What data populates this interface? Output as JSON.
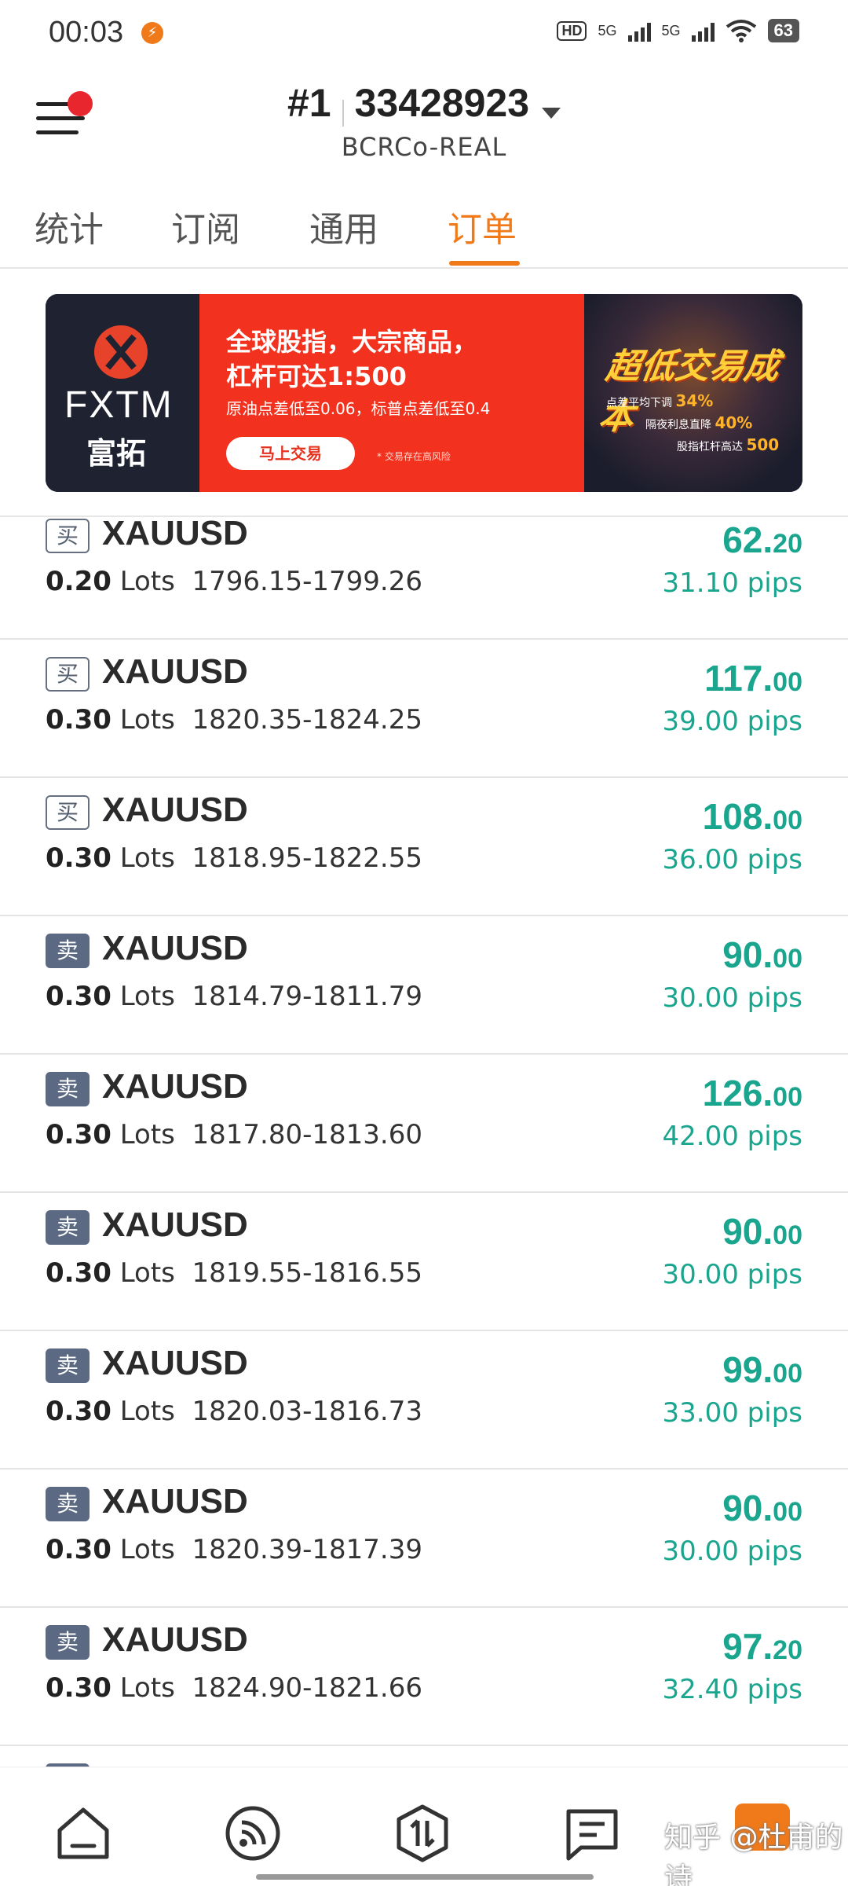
{
  "status_bar": {
    "time": "00:03",
    "hd": "HD",
    "net1": "5G",
    "net2": "5G",
    "battery": "63"
  },
  "header": {
    "account_prefix": "#1",
    "account_number": "33428923",
    "server": "BCRCo-REAL"
  },
  "tabs": [
    {
      "label": "统计",
      "active": false
    },
    {
      "label": "订阅",
      "active": false
    },
    {
      "label": "通用",
      "active": false
    },
    {
      "label": "订单",
      "active": true
    }
  ],
  "banner": {
    "brand": "FXTM",
    "brand_cn": "富拓",
    "headline1": "全球股指，大宗商品，",
    "headline2": "杠杆可达1:500",
    "subline": "原油点差低至0.06，标普点差低至0.4",
    "cta": "马上交易",
    "risk": "* 交易存在高风险",
    "promo_title": "超低交易成本",
    "promo1_text": "点差平均下调",
    "promo1_value": "34%",
    "promo2_text": "隔夜利息直降",
    "promo2_value": "40%",
    "promo3_text": "股指杠杆高达",
    "promo3_value": "500"
  },
  "orders": [
    {
      "side": "买",
      "type": "buy",
      "symbol": "XAUUSD",
      "lots": "0.20",
      "lots_unit": "Lots",
      "prices": "1796.15-1799.26",
      "profit_int": "62.",
      "profit_dec": "20",
      "pips": "31.10 pips"
    },
    {
      "side": "买",
      "type": "buy",
      "symbol": "XAUUSD",
      "lots": "0.30",
      "lots_unit": "Lots",
      "prices": "1820.35-1824.25",
      "profit_int": "117.",
      "profit_dec": "00",
      "pips": "39.00 pips"
    },
    {
      "side": "买",
      "type": "buy",
      "symbol": "XAUUSD",
      "lots": "0.30",
      "lots_unit": "Lots",
      "prices": "1818.95-1822.55",
      "profit_int": "108.",
      "profit_dec": "00",
      "pips": "36.00 pips"
    },
    {
      "side": "卖",
      "type": "sell",
      "symbol": "XAUUSD",
      "lots": "0.30",
      "lots_unit": "Lots",
      "prices": "1814.79-1811.79",
      "profit_int": "90.",
      "profit_dec": "00",
      "pips": "30.00 pips"
    },
    {
      "side": "卖",
      "type": "sell",
      "symbol": "XAUUSD",
      "lots": "0.30",
      "lots_unit": "Lots",
      "prices": "1817.80-1813.60",
      "profit_int": "126.",
      "profit_dec": "00",
      "pips": "42.00 pips"
    },
    {
      "side": "卖",
      "type": "sell",
      "symbol": "XAUUSD",
      "lots": "0.30",
      "lots_unit": "Lots",
      "prices": "1819.55-1816.55",
      "profit_int": "90.",
      "profit_dec": "00",
      "pips": "30.00 pips"
    },
    {
      "side": "卖",
      "type": "sell",
      "symbol": "XAUUSD",
      "lots": "0.30",
      "lots_unit": "Lots",
      "prices": "1820.03-1816.73",
      "profit_int": "99.",
      "profit_dec": "00",
      "pips": "33.00 pips"
    },
    {
      "side": "卖",
      "type": "sell",
      "symbol": "XAUUSD",
      "lots": "0.30",
      "lots_unit": "Lots",
      "prices": "1820.39-1817.39",
      "profit_int": "90.",
      "profit_dec": "00",
      "pips": "30.00 pips"
    },
    {
      "side": "卖",
      "type": "sell",
      "symbol": "XAUUSD",
      "lots": "0.30",
      "lots_unit": "Lots",
      "prices": "1824.90-1821.66",
      "profit_int": "97.",
      "profit_dec": "20",
      "pips": "32.40 pips"
    }
  ],
  "bottom_nav": {
    "items": [
      "home-icon",
      "signal-feed-icon",
      "trade-icon",
      "messages-icon",
      "orders-badge-icon"
    ],
    "watermark": "知乎 @杜甫的诗"
  },
  "colors": {
    "accent": "#f07a1a",
    "profit": "#1aa58e",
    "sell_badge": "#5b6a82",
    "banner_red": "#f2321e"
  }
}
